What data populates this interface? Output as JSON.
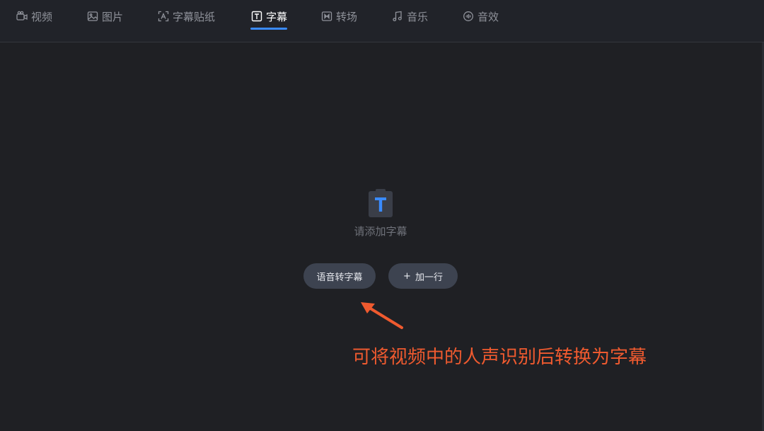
{
  "tabs": [
    {
      "label": "视频",
      "icon": "video-camera-icon",
      "active": false
    },
    {
      "label": "图片",
      "icon": "image-icon",
      "active": false
    },
    {
      "label": "字幕贴纸",
      "icon": "sticker-icon",
      "active": false
    },
    {
      "label": "字幕",
      "icon": "text-t-icon",
      "active": true
    },
    {
      "label": "转场",
      "icon": "transition-icon",
      "active": false
    },
    {
      "label": "音乐",
      "icon": "music-note-icon",
      "active": false
    },
    {
      "label": "音效",
      "icon": "sound-effect-icon",
      "active": false
    }
  ],
  "empty_state": {
    "icon": "subtitle-t-icon",
    "text": "请添加字幕"
  },
  "actions": {
    "speech_to_subtitle": "语音转字幕",
    "add_line_plus": "+",
    "add_line": "加一行"
  },
  "annotation": {
    "text": "可将视频中的人声识别后转换为字幕",
    "color": "#ef5a2f"
  },
  "colors": {
    "background": "#1f2024",
    "accent": "#3a8bff",
    "button": "#3d4350"
  }
}
